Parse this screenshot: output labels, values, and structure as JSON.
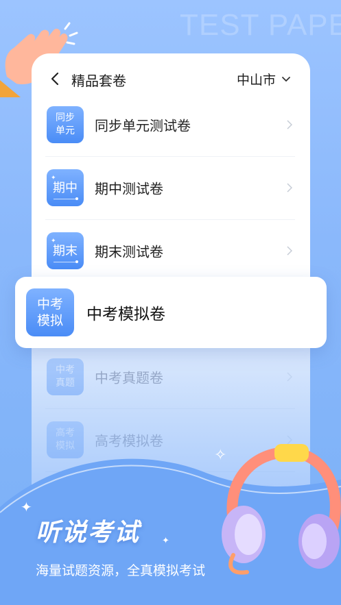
{
  "background_text": "TEST PAPE",
  "header": {
    "title": "精品套卷",
    "city": "中山市"
  },
  "rows": [
    {
      "icon_line1": "同步",
      "icon_line2": "单元",
      "label": "同步单元测试卷"
    },
    {
      "icon_text": "期中",
      "label": "期中测试卷"
    },
    {
      "icon_text": "期末",
      "label": "期末测试卷"
    },
    {
      "icon_line1": "中考",
      "icon_line2": "真题",
      "label": "中考真题卷"
    },
    {
      "icon_line1": "高考",
      "icon_line2": "模拟",
      "label": "高考模拟卷"
    }
  ],
  "highlight": {
    "icon_line1": "中考",
    "icon_line2": "模拟",
    "label": "中考模拟卷"
  },
  "promo": {
    "title": "听说考试",
    "subtitle": "海量试题资源，全真模拟考试"
  },
  "colors": {
    "accent": "#4a8cf6",
    "background": "#8ab8fb"
  }
}
